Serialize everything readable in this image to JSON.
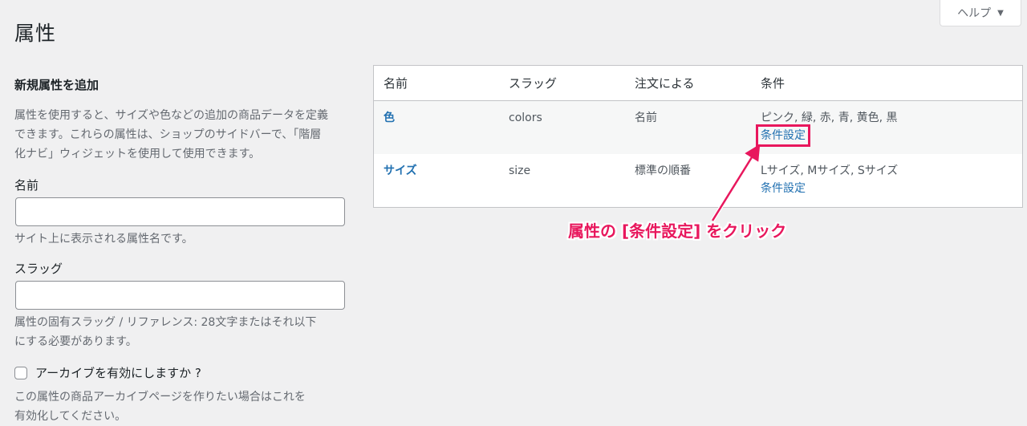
{
  "help": {
    "label": "ヘルプ",
    "caret": "▼"
  },
  "page": {
    "title": "属性"
  },
  "add_form": {
    "heading": "新規属性を追加",
    "description_lines": [
      "属性を使用すると、サイズや色などの追加の商品データを定義",
      "できます。これらの属性は、ショップのサイドバーで、「階層",
      "化ナビ」ウィジェットを使用して使用できます。"
    ],
    "name_label": "名前",
    "name_value": "",
    "name_help": "サイト上に表示される属性名です。",
    "slug_label": "スラッグ",
    "slug_value": "",
    "slug_help_lines": [
      "属性の固有スラッグ / リファレンス: 28文字またはそれ以下",
      "にする必要があります。"
    ],
    "archive_label": "アーカイブを有効にしますか ?",
    "archive_help_lines": [
      "この属性の商品アーカイブページを作りたい場合はこれを",
      "有効化してください。"
    ]
  },
  "table": {
    "headers": [
      "名前",
      "スラッグ",
      "注文による",
      "条件"
    ],
    "rows": [
      {
        "name": "色",
        "slug": "colors",
        "order_by": "名前",
        "terms": "ピンク, 緑, 赤, 青, 黄色, 黒",
        "configure_link": "条件設定"
      },
      {
        "name": "サイズ",
        "slug": "size",
        "order_by": "標準の順番",
        "terms": "Lサイズ, Mサイズ, Sサイズ",
        "configure_link": "条件設定"
      }
    ]
  },
  "annotation": {
    "text": "属性の [条件設定] をクリック",
    "color": "#e8175d"
  },
  "colors": {
    "accent_link": "#2271b1",
    "annotation": "#e8175d",
    "background": "#f0f0f1"
  }
}
